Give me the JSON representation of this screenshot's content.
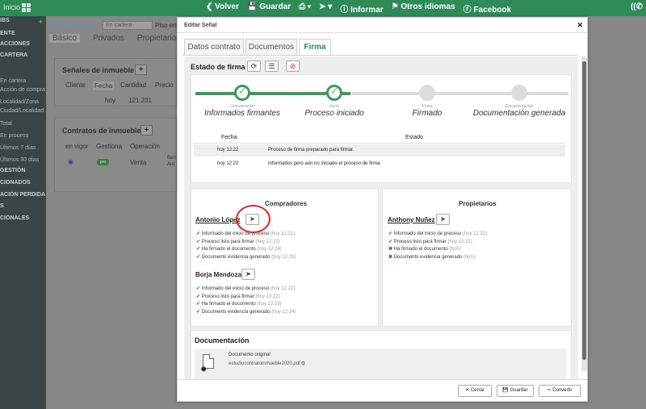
{
  "topbar": {
    "inicio": "Inicio",
    "menu": [
      {
        "icon": "chevron-left-icon",
        "label": "❮ Volver"
      },
      {
        "icon": "save-icon",
        "label": "💾 Guardar"
      },
      {
        "icon": "print-icon",
        "label": "⎙ ▾"
      },
      {
        "icon": "send-icon",
        "label": "➤ ▾"
      },
      {
        "icon": "info-icon",
        "label": "ⓘ Informar"
      },
      {
        "icon": "flag-icon",
        "label": "⚑ Otros idiomas"
      },
      {
        "icon": "facebook-icon",
        "label": "ⓕ Facebook"
      }
    ],
    "phone": "((✆"
  },
  "sidebar": {
    "items": [
      {
        "label": "IBS",
        "bold": true
      },
      {
        "label": "ENTE",
        "bold": true
      },
      {
        "label": "ACCIONES",
        "bold": true
      },
      {
        "label": "CARTERA",
        "bold": true
      },
      {
        "label": "En cartera",
        "bold": false
      },
      {
        "label": "Acción de compra",
        "bold": false
      },
      {
        "label": "Localidad/Zona",
        "bold": false
      },
      {
        "label": "Ciudad/Localidad",
        "bold": false
      },
      {
        "label": "Total",
        "bold": false
      },
      {
        "label": "En proceso",
        "bold": false
      },
      {
        "label": "Últimos 7 días",
        "bold": false
      },
      {
        "label": "Últimos 30 días",
        "bold": false
      },
      {
        "label": "GESTIÓN",
        "bold": true
      },
      {
        "label": "CIONADOS",
        "bold": true
      },
      {
        "label": "ACIÓN PERDIDA",
        "bold": true
      },
      {
        "label": "S",
        "bold": true
      },
      {
        "label": "CIONALES",
        "bold": true
      }
    ]
  },
  "background": {
    "title": "#2040469",
    "select_value": "En cartera",
    "piso": "Piso en",
    "tabs": [
      "Básico",
      "Privados",
      "Propietarios"
    ],
    "senales_title": "Señales de inmueble",
    "senales_headers": [
      "Cliente",
      "Fecha",
      "Cantidad",
      "Precio"
    ],
    "senales_row": [
      "hoy",
      "121.231"
    ],
    "contratos_title": "Contratos de inmueble",
    "contratos_headers": [
      "en vigor",
      "Gestiona",
      "Operación"
    ],
    "contratos_badge": "pro",
    "contratos_row": [
      "Venta",
      "Ben",
      "Ant"
    ]
  },
  "modal": {
    "title": "Editar Señal",
    "tabs": [
      "Datos contrato",
      "Documentos",
      "Firma"
    ],
    "estado_title": "Estado de firma",
    "steps": [
      {
        "small": "Comunicación",
        "label": "Informados firmantes",
        "done": true
      },
      {
        "small": "Inicio",
        "label": "Proceso iniciado",
        "done": true
      },
      {
        "small": "Firma",
        "label": "Firmado",
        "done": false
      },
      {
        "small": "Documentación",
        "label": "Documentación generada",
        "done": false
      }
    ],
    "progress_fraction": 0.33,
    "table": {
      "headers": [
        "Fecha",
        "Estado"
      ],
      "rows": [
        {
          "fecha": "hoy 12:22",
          "estado": "Proceso de firma preparado para firmar."
        },
        {
          "fecha": "hoy 12:22",
          "estado": "Informados pero aún no iniciado el proceso de firma."
        }
      ]
    },
    "compradores": {
      "title": "Compradores",
      "persons": [
        {
          "name": "Antonio López",
          "events": [
            {
              "ok": true,
              "text": "Informado del inicio de proceso",
              "time": "(hoy 12:22)"
            },
            {
              "ok": true,
              "text": "Proceso listo para firmar",
              "time": "(hoy 12:22)"
            },
            {
              "ok": true,
              "text": "Ha firmado el documento",
              "time": "(hoy 12:24)"
            },
            {
              "ok": true,
              "text": "Documento evidencia generado",
              "time": "(hoy 12:25)"
            }
          ]
        },
        {
          "name": "Borja Mendoza",
          "events": [
            {
              "ok": true,
              "text": "Informado del inicio de proceso",
              "time": "(hoy 12:22)"
            },
            {
              "ok": true,
              "text": "Proceso listo para firmar",
              "time": "(hoy 12:22)"
            },
            {
              "ok": true,
              "text": "Ha firmado el documento",
              "time": "(hoy 12:23)"
            },
            {
              "ok": true,
              "text": "Documento evidencia generado",
              "time": "(hoy 12:24)"
            }
          ]
        }
      ]
    },
    "propietarios": {
      "title": "Propietarios",
      "persons": [
        {
          "name": "Anthony Nuñez",
          "events": [
            {
              "ok": true,
              "text": "Informado del inicio de proceso",
              "time": "(hoy 12:22)"
            },
            {
              "ok": true,
              "text": "Proceso listo para firmar",
              "time": "(hoy 12:22)"
            },
            {
              "ok": false,
              "text": "Ha firmado el documento",
              "time": "(N/A)"
            },
            {
              "ok": false,
              "text": "Documento evidencia generado",
              "time": "(N/A)"
            }
          ]
        }
      ]
    },
    "documentacion": {
      "title": "Documentación",
      "doc_name": "Documento original",
      "doc_file": "estudiocontratoinmueble2020.pdf"
    },
    "footer": {
      "cerrar": "✕ Cerrar",
      "guardar": "💾 Guardar",
      "convertir": "⇨ Convertir"
    }
  },
  "colors": {
    "brand": "#2e8b57",
    "progress": "#3c9a5f",
    "error": "#d22222",
    "highlight": "#e02424"
  }
}
